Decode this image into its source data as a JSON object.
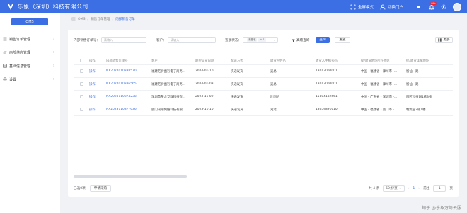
{
  "header": {
    "brand": "乐象（深圳）科技有限公司",
    "fullscreen_label": "全屏模式",
    "switch_portal_label": "切换门户",
    "notification_count": "99+",
    "accent_color": "#3b6fe3"
  },
  "sidebar": {
    "app_button": "OMS",
    "items": [
      {
        "label": "销售订单管理",
        "icon": "list-icon"
      },
      {
        "label": "内部供应管理",
        "icon": "transfer-icon"
      },
      {
        "label": "基础信息管理",
        "icon": "database-icon"
      },
      {
        "label": "设置",
        "icon": "gear-icon"
      }
    ]
  },
  "breadcrumb": {
    "items": [
      "OMS",
      "销售订单管理",
      "内部销售订单"
    ]
  },
  "filters": {
    "order_no_label": "内部销售订单号：",
    "order_no_placeholder": "请输入",
    "customer_label": "客户：",
    "customer_placeholder": "请输入",
    "status_label": "签收状态：",
    "status_chip": "未签收",
    "status_more": "+ 1",
    "advanced_label": "高级查询",
    "search_label": "查询",
    "reset_label": "重置",
    "more_label": "更多"
  },
  "table": {
    "columns": [
      "操作",
      "内部销售订单号",
      "客户",
      "期望交货日期",
      "配送方式",
      "收货人姓名",
      "收货人手机号码",
      "提/收货地址所在地区",
      "提/收货详细地址"
    ],
    "rows": [
      {
        "action": "操作",
        "order_no": "NX2024010338570",
        "customer": "福建宅护出行电子商务...",
        "date": "2024-01-10",
        "delivery": "快递发货",
        "receiver": "吴总",
        "phone": "13013000001",
        "region": "中国 - 福建省 - 漳州市 -...",
        "address": "留仙一路"
      },
      {
        "action": "操作",
        "order_no": "NX2024010386565",
        "customer": "福建宅护出行电子商务...",
        "date": "2024-01-03",
        "delivery": "快递发货",
        "receiver": "吴总",
        "phone": "13013000001",
        "region": "中国 - 福建省 - 漳州市 -...",
        "address": "留仙一路"
      },
      {
        "action": "操作",
        "order_no": "NX2023110874238",
        "customer": "深圳鼎整龙互联科技有...",
        "date": "2023-11-09",
        "delivery": "快递发货",
        "receiver": "叶国豹",
        "phone": "15804132561",
        "region": "中国 - 广东省 - 深圳市 -...",
        "address": "南区科技园1栋3楼"
      },
      {
        "action": "操作",
        "order_no": "NX2023110877636",
        "customer": "厦门讯潮网络科技有限...",
        "date": "2023-11-10",
        "delivery": "快递发货",
        "receiver": "刘达",
        "phone": "18059891610",
        "region": "中国 - 福建省 - 厦门市 -...",
        "address": "物流园2栋1楼"
      }
    ]
  },
  "footer": {
    "selected_label": "已选0项",
    "apply_button": "申请采购",
    "total_label": "共 4 条",
    "page_size": "50条/页",
    "current_page": "1",
    "goto_label": "前往",
    "goto_value": "1",
    "page_unit": "页"
  },
  "watermark": "知乎 @乐象万与云服"
}
